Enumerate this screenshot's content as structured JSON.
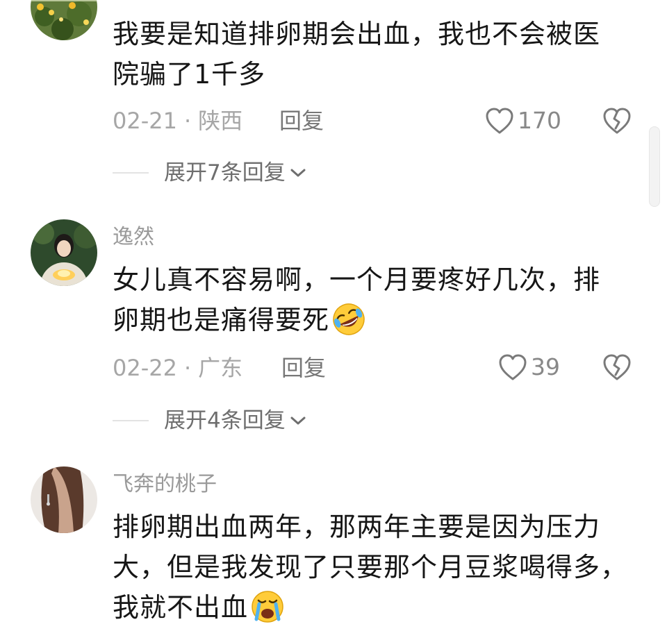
{
  "comments": [
    {
      "username": "",
      "lines": [
        "我要是知道排卵期会出血，我也不会被医",
        "院骗了1千多"
      ],
      "date": "02-21",
      "location": "陕西",
      "reply_label": "回复",
      "likes": "170",
      "expand_label": "展开7条回复",
      "avatar_icon": "flower-garden-avatar",
      "emoji": ""
    },
    {
      "username": "逸然",
      "lines": [
        "女儿真不容易啊，一个月要疼好几次，排",
        "卵期也是痛得要死"
      ],
      "date": "02-22",
      "location": "广东",
      "reply_label": "回复",
      "likes": "39",
      "expand_label": "展开4条回复",
      "avatar_icon": "woman-with-lantern-avatar",
      "emoji": "rolling-laughing-emoji"
    },
    {
      "username": "飞奔的桃子",
      "lines": [
        "排卵期出血两年，那两年主要是因为压力",
        "大，但是我发现了只要那个月豆浆喝得多，",
        "我就不出血"
      ],
      "avatar_icon": "woman-long-hair-avatar",
      "emoji": "crying-emoji"
    }
  ],
  "separator": "·",
  "icons": {
    "like": "heart-outline-icon",
    "dislike": "broken-heart-icon",
    "expand": "chevron-down-icon"
  },
  "colors": {
    "meta_text": "#a6a6a6",
    "body_text": "#161616",
    "icon_stroke": "#7a7a7a"
  }
}
